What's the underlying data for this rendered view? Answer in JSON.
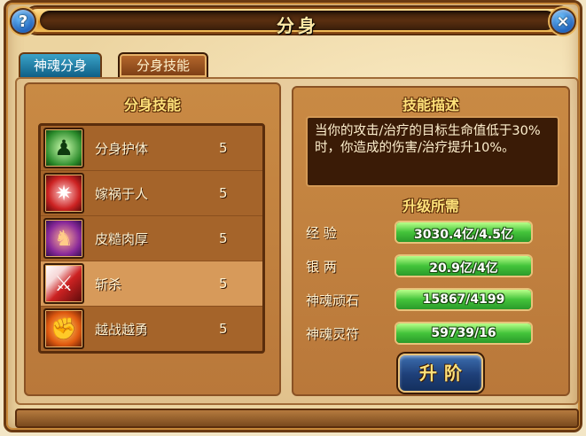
{
  "window": {
    "title": "分身",
    "help_icon": "?",
    "close_icon": "×"
  },
  "tabs": [
    {
      "label": "神魂分身",
      "active": false
    },
    {
      "label": "分身技能",
      "active": true
    }
  ],
  "skills_panel": {
    "heading": "分身技能",
    "skills": [
      {
        "name": "分身护体",
        "level": "5",
        "icon": "meditating-figure-icon"
      },
      {
        "name": "嫁祸于人",
        "level": "5",
        "icon": "red-burst-icon"
      },
      {
        "name": "皮糙肉厚",
        "level": "5",
        "icon": "armored-figure-icon"
      },
      {
        "name": "斩杀",
        "level": "5",
        "icon": "blade-slash-icon",
        "selected": true
      },
      {
        "name": "越战越勇",
        "level": "5",
        "icon": "fiery-fist-icon"
      }
    ]
  },
  "detail_panel": {
    "desc_heading": "技能描述",
    "description": "当你的攻击/治疗的目标生命值低于30%时，你造成的伤害/治疗提升10%。",
    "req_heading": "升级所需",
    "requirements": [
      {
        "label": "经 验",
        "value": "3030.4亿/4.5亿",
        "fill": 1.0
      },
      {
        "label": "银 两",
        "value": "20.9亿/4亿",
        "fill": 1.0
      },
      {
        "label": "神魂顽石",
        "value": "15867/4199",
        "fill": 1.0
      },
      {
        "label": "神魂灵符",
        "value": "59739/16",
        "fill": 1.0
      }
    ],
    "upgrade_label": "升阶"
  }
}
